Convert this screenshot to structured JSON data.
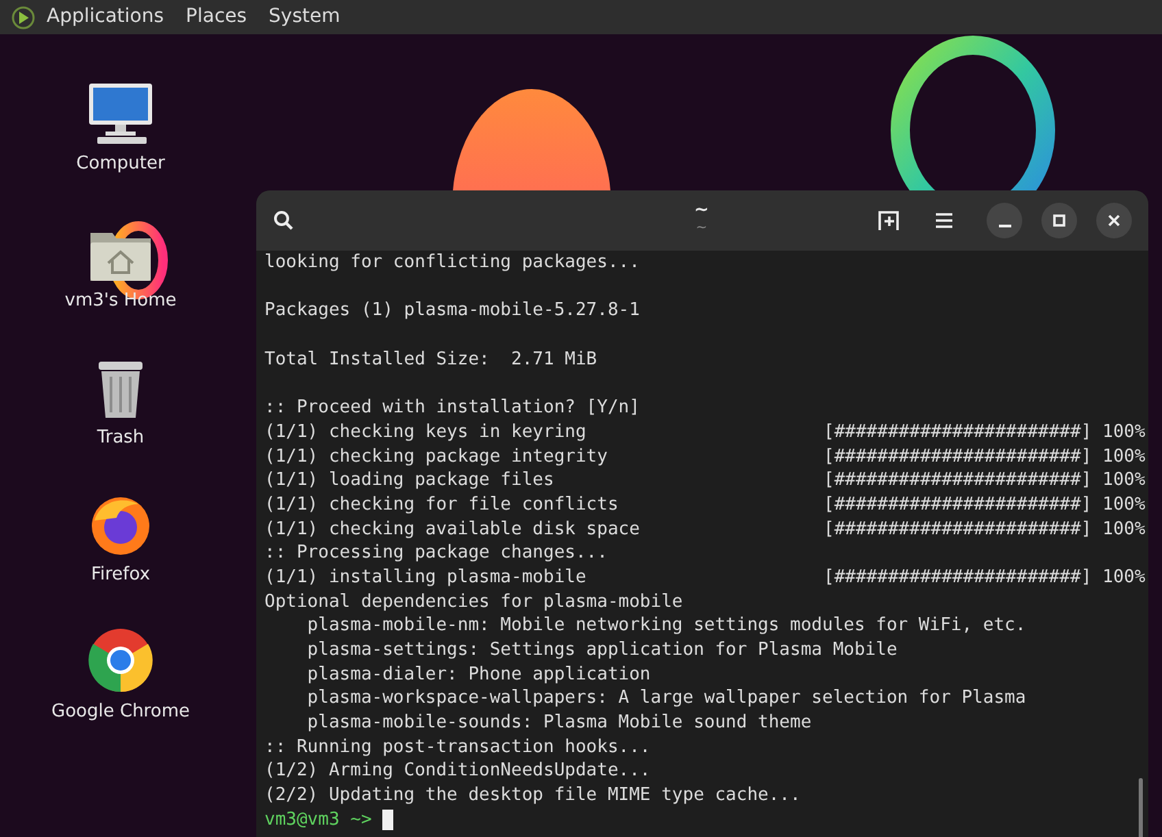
{
  "top_panel": {
    "menus": [
      "Applications",
      "Places",
      "System"
    ]
  },
  "desktop_icons": [
    {
      "kind": "computer",
      "label": "Computer"
    },
    {
      "kind": "home",
      "label": "vm3's Home"
    },
    {
      "kind": "trash",
      "label": "Trash"
    },
    {
      "kind": "firefox",
      "label": "Firefox"
    },
    {
      "kind": "chrome",
      "label": "Google Chrome"
    }
  ],
  "terminal": {
    "title": "~",
    "subtitle": "~",
    "lines": [
      {
        "text": "looking for conflicting packages..."
      },
      {
        "text": "Packages (1) plasma-mobile-5.27.8-1",
        "blank_line_before": true
      },
      {
        "text": "Total Installed Size:  2.71 MiB",
        "blank_line_before": true
      },
      {
        "text": ":: Proceed with installation? [Y/n]",
        "blank_line_before": true
      },
      {
        "text": "(1/1) checking keys in keyring",
        "progress": "[#######################] 100%"
      },
      {
        "text": "(1/1) checking package integrity",
        "progress": "[#######################] 100%"
      },
      {
        "text": "(1/1) loading package files",
        "progress": "[#######################] 100%"
      },
      {
        "text": "(1/1) checking for file conflicts",
        "progress": "[#######################] 100%"
      },
      {
        "text": "(1/1) checking available disk space",
        "progress": "[#######################] 100%"
      },
      {
        "text": ":: Processing package changes..."
      },
      {
        "text": "(1/1) installing plasma-mobile",
        "progress": "[#######################] 100%"
      },
      {
        "text": "Optional dependencies for plasma-mobile"
      },
      {
        "text": "    plasma-mobile-nm: Mobile networking settings modules for WiFi, etc."
      },
      {
        "text": "    plasma-settings: Settings application for Plasma Mobile"
      },
      {
        "text": "    plasma-dialer: Phone application"
      },
      {
        "text": "    plasma-workspace-wallpapers: A large wallpaper selection for Plasma"
      },
      {
        "text": "    plasma-mobile-sounds: Plasma Mobile sound theme"
      },
      {
        "text": ":: Running post-transaction hooks..."
      },
      {
        "text": "(1/2) Arming ConditionNeedsUpdate..."
      },
      {
        "text": "(2/2) Updating the desktop file MIME type cache..."
      }
    ],
    "prompt": "vm3@vm3 ~>"
  }
}
